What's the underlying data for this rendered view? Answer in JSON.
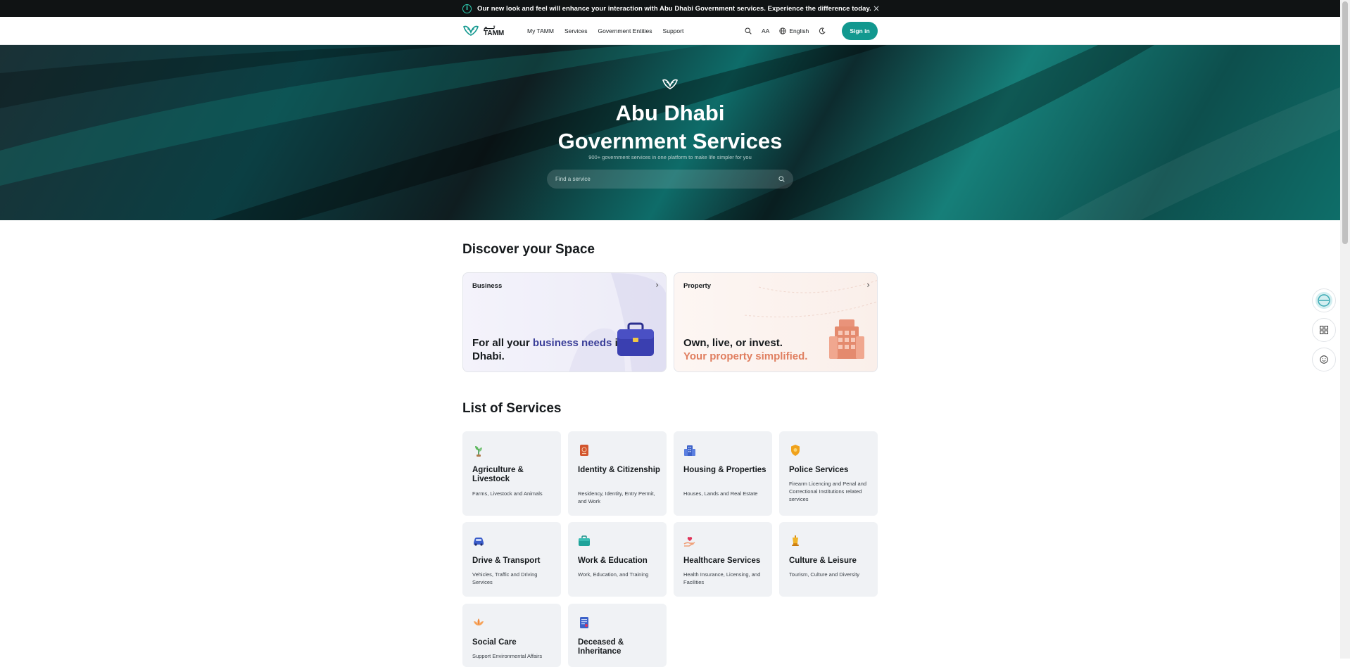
{
  "announcement": {
    "text": "Our new look and feel will enhance your interaction with Abu Dhabi Government services. Experience the difference today.",
    "info_icon": "i",
    "close_icon": "×"
  },
  "header": {
    "logo": {
      "arabic": "تـــم",
      "latin": "TAMM"
    },
    "nav": [
      "My TAMM",
      "Services",
      "Government Entities",
      "Support"
    ],
    "font_size_label": "AA",
    "language_label": "English",
    "signin_label": "Sign in"
  },
  "hero": {
    "title_line1": "Abu Dhabi",
    "title_line2": "Government Services",
    "subtitle": "900+ government services in one platform to make life simpler for you",
    "search_placeholder": "Find a service"
  },
  "discover": {
    "title": "Discover your Space",
    "business": {
      "label": "Business",
      "text_a": "For all your ",
      "text_b": "business needs",
      "text_c": " in Abu Dhabi."
    },
    "property": {
      "label": "Property",
      "line1": "Own, live, or invest.",
      "line2": "Your property simplified."
    }
  },
  "services": {
    "title": "List of Services",
    "items": [
      {
        "title": "Agriculture & Livestock",
        "desc": "Farms, Livestock and Animals",
        "icon": "plant-icon"
      },
      {
        "title": "Identity & Citizenship",
        "desc": "Residency, Identity, Entry Permit, and Work",
        "icon": "passport-icon"
      },
      {
        "title": "Housing & Properties",
        "desc": "Houses, Lands and Real Estate",
        "icon": "buildings-icon"
      },
      {
        "title": "Police Services",
        "desc": "Firearm Licencing and Penal and Correctional Institutions related services",
        "icon": "police-badge-icon"
      },
      {
        "title": "Drive & Transport",
        "desc": "Vehicles, Traffic and Driving Services",
        "icon": "car-icon"
      },
      {
        "title": "Work & Education",
        "desc": "Work, Education, and Training",
        "icon": "briefcase-icon"
      },
      {
        "title": "Healthcare Services",
        "desc": "Health Insurance, Licensing, and Facilities",
        "icon": "heart-hand-icon"
      },
      {
        "title": "Culture & Leisure",
        "desc": "Tourism, Culture and Diversity",
        "icon": "lamp-icon"
      },
      {
        "title": "Social Care",
        "desc": "Support Environmental Affairs",
        "icon": "lotus-icon"
      },
      {
        "title": "Deceased & Inheritance",
        "desc": "",
        "icon": "document-icon"
      }
    ]
  },
  "colors": {
    "brand_teal": "#12988f",
    "business_accent": "#3b3f99",
    "property_accent": "#e07f60",
    "announcement_bg": "#101314"
  }
}
